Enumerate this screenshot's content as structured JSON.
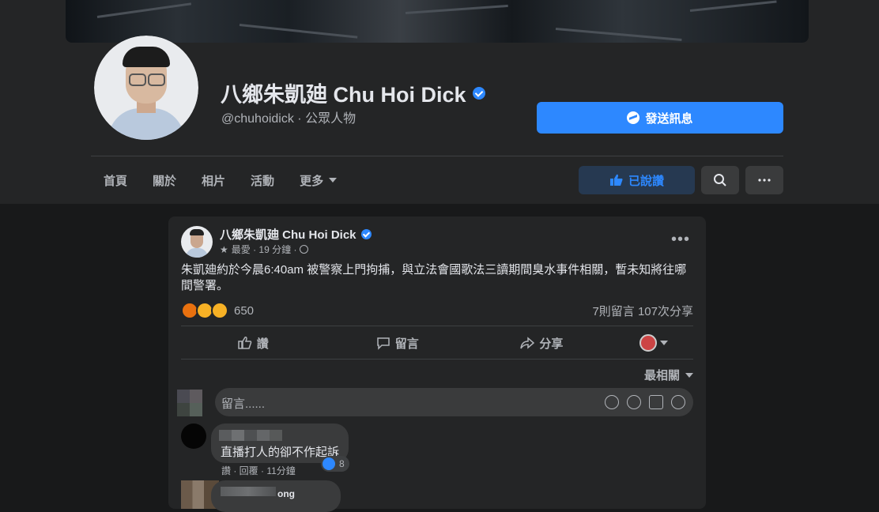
{
  "profile": {
    "name": "八鄉朱凱廸 Chu Hoi Dick",
    "handle": "@chuhoidick · 公眾人物",
    "send_message_label": "發送訊息"
  },
  "nav": {
    "items": [
      "首頁",
      "關於",
      "相片",
      "活動"
    ],
    "more_label": "更多",
    "liked_label": "已說讚"
  },
  "post": {
    "author": "八鄉朱凱廸 Chu Hoi Dick",
    "meta": "最愛 · 19 分鐘 ·",
    "text": "朱凱廸約於今晨6:40am 被警察上門拘捕，與立法會國歌法三讀期間臭水事件相關，暫未知將往哪間警署。",
    "reaction_count": "650",
    "stats": "7則留言  107次分享",
    "actions": {
      "like": "讚",
      "comment": "留言",
      "share": "分享"
    },
    "sort_label": "最相關",
    "comment_placeholder": "留言......"
  },
  "comments": [
    {
      "text": "直播打人的卻不作起訴",
      "likes": "8",
      "meta": "讚 · 回覆 · 11分鐘"
    },
    {
      "name_tail": "ong"
    }
  ],
  "colors": {
    "accent": "#2d88ff",
    "bg": "#18191a",
    "surface": "#242526"
  }
}
